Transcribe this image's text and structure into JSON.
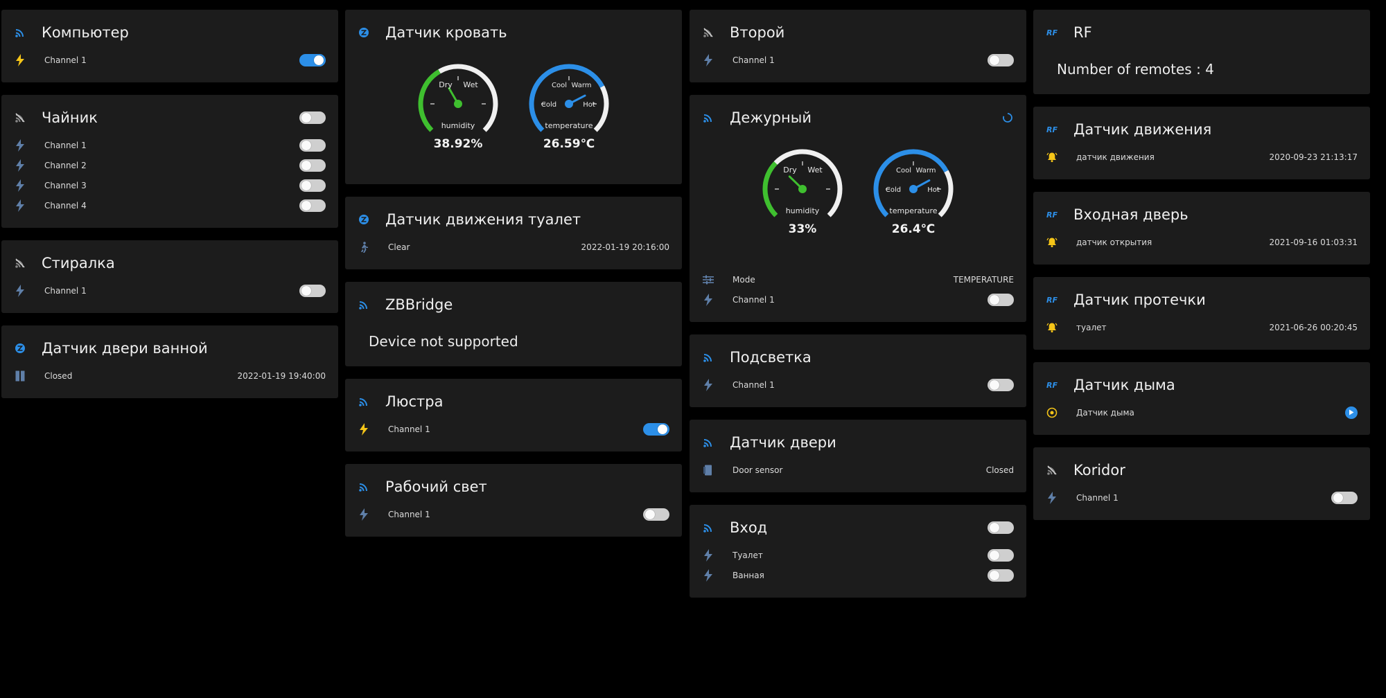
{
  "colors": {
    "accent": "#2c8fe8",
    "bolt_on": "#f5c518",
    "bolt_off": "#5f7fa8",
    "green": "#3fbf2f",
    "bell": "#f5c518"
  },
  "columns": [
    [
      {
        "id": "kompyuter",
        "icon": "wifi-icon",
        "title": "Компьютер",
        "rows": [
          {
            "icon": "bolt-on",
            "label": "Channel 1",
            "toggle": true
          }
        ]
      },
      {
        "id": "chainik",
        "icon": "wifi-off-icon",
        "title": "Чайник",
        "head_toggle": false,
        "rows": [
          {
            "icon": "bolt-off",
            "label": "Channel 1",
            "toggle": false
          },
          {
            "icon": "bolt-off",
            "label": "Channel 2",
            "toggle": false
          },
          {
            "icon": "bolt-off",
            "label": "Channel 3",
            "toggle": false
          },
          {
            "icon": "bolt-off",
            "label": "Channel 4",
            "toggle": false
          }
        ]
      },
      {
        "id": "stiralka",
        "icon": "wifi-off-icon",
        "title": "Стиралка",
        "rows": [
          {
            "icon": "bolt-off",
            "label": "Channel 1",
            "toggle": false
          }
        ]
      },
      {
        "id": "datchik-dveri-vannoy",
        "icon": "zigbee-icon",
        "title": "Датчик двери ванной",
        "rows": [
          {
            "icon": "door-closed",
            "label": "Closed",
            "value": "2022-01-19 19:40:00"
          }
        ]
      }
    ],
    [
      {
        "id": "datchik-krovat",
        "icon": "zigbee-icon",
        "title": "Датчик кровать",
        "gauges": [
          {
            "kind": "humidity",
            "value_text": "38.92%",
            "value": 38.92,
            "l1": "Dry",
            "l2": "Wet",
            "name": "humidity"
          },
          {
            "kind": "temperature",
            "value_text": "26.59℃",
            "value": 26.59,
            "l1": "Cool",
            "l2": "Warm",
            "l3": "Cold",
            "l4": "Hot",
            "name": "temperature"
          }
        ]
      },
      {
        "id": "datchik-dvizheniya-tualet",
        "icon": "zigbee-icon",
        "title": "Датчик движения туалет",
        "rows": [
          {
            "icon": "walk-icon",
            "label": "Clear",
            "value": "2022-01-19 20:16:00"
          }
        ]
      },
      {
        "id": "zbbridge",
        "icon": "wifi-icon",
        "title": "ZBBridge",
        "text": "Device not supported"
      },
      {
        "id": "lyustra",
        "icon": "wifi-icon",
        "title": "Люстра",
        "rows": [
          {
            "icon": "bolt-on",
            "label": "Channel 1",
            "toggle": true
          }
        ]
      },
      {
        "id": "rabochiy-svet",
        "icon": "wifi-icon",
        "title": "Рабочий свет",
        "rows": [
          {
            "icon": "bolt-off",
            "label": "Channel 1",
            "toggle": false
          }
        ]
      }
    ],
    [
      {
        "id": "vtoroy",
        "icon": "wifi-off-icon",
        "title": "Второй",
        "rows": [
          {
            "icon": "bolt-off",
            "label": "Channel 1",
            "toggle": false
          }
        ]
      },
      {
        "id": "dezhurny",
        "icon": "wifi-icon",
        "title": "Дежурный",
        "head_spinner": true,
        "gauges": [
          {
            "kind": "humidity",
            "value_text": "33%",
            "value": 33,
            "l1": "Dry",
            "l2": "Wet",
            "name": "humidity"
          },
          {
            "kind": "temperature",
            "value_text": "26.4℃",
            "value": 26.4,
            "l1": "Cool",
            "l2": "Warm",
            "l3": "Cold",
            "l4": "Hot",
            "name": "temperature"
          }
        ],
        "rows": [
          {
            "icon": "sliders-icon",
            "label": "Mode",
            "value": "TEMPERATURE"
          },
          {
            "icon": "bolt-off",
            "label": "Channel 1",
            "toggle": false
          }
        ]
      },
      {
        "id": "podsvetka",
        "icon": "wifi-icon",
        "title": "Подсветка",
        "rows": [
          {
            "icon": "bolt-off",
            "label": "Channel 1",
            "toggle": false
          }
        ]
      },
      {
        "id": "datchik-dveri",
        "icon": "wifi-icon",
        "title": "Датчик двери",
        "rows": [
          {
            "icon": "door-sensor",
            "label": "Door sensor",
            "value": "Closed"
          }
        ]
      },
      {
        "id": "vhod",
        "icon": "wifi-icon",
        "title": "Вход",
        "head_toggle": false,
        "rows": [
          {
            "icon": "bolt-off",
            "label": "Туалет",
            "toggle": false
          },
          {
            "icon": "bolt-off",
            "label": "Ванная",
            "toggle": false
          }
        ]
      }
    ],
    [
      {
        "id": "rf",
        "icon": "rf-icon",
        "title": "RF",
        "text": "Number of remotes : 4"
      },
      {
        "id": "datchik-dvizheniya",
        "icon": "rf-icon",
        "title": "Датчик движения",
        "rows": [
          {
            "icon": "bell-icon",
            "label": "датчик движения",
            "value": "2020-09-23 21:13:17"
          }
        ]
      },
      {
        "id": "vhodnaya-dver",
        "icon": "rf-icon",
        "title": "Входная дверь",
        "rows": [
          {
            "icon": "bell-icon",
            "label": "датчик открытия",
            "value": "2021-09-16 01:03:31"
          }
        ]
      },
      {
        "id": "datchik-protechki",
        "icon": "rf-icon",
        "title": "Датчик протечки",
        "rows": [
          {
            "icon": "bell-icon",
            "label": "туалет",
            "value": "2021-06-26 00:20:45"
          }
        ]
      },
      {
        "id": "datchik-dyma",
        "icon": "rf-icon",
        "title": "Датчик дыма",
        "rows": [
          {
            "icon": "smoke-icon",
            "label": "Датчик дыма",
            "play": true
          }
        ]
      },
      {
        "id": "koridor",
        "icon": "wifi-off-icon",
        "title": "Koridor",
        "rows": [
          {
            "icon": "bolt-off",
            "label": "Channel 1",
            "toggle": false
          }
        ]
      }
    ]
  ],
  "rf_label": "RF"
}
